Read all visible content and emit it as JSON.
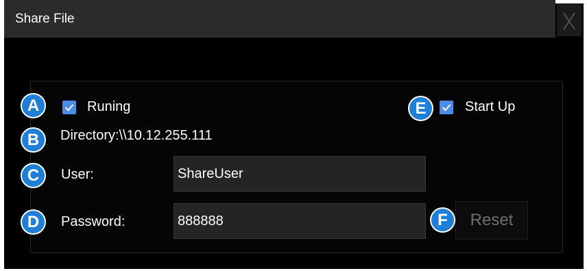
{
  "dialog": {
    "title": "Share File",
    "close_icon": "close-icon"
  },
  "badges": [
    "A",
    "B",
    "C",
    "D",
    "E",
    "F"
  ],
  "running": {
    "label": "Runing",
    "checked": true
  },
  "startup": {
    "label": "Start Up",
    "checked": true
  },
  "directory": {
    "label": "Directory:\\\\10.12.255.111"
  },
  "user": {
    "label": "User:",
    "value": "ShareUser"
  },
  "password": {
    "label": "Password:",
    "value": "888888"
  },
  "reset": {
    "label": "Reset"
  },
  "colors": {
    "background": "#000000",
    "titlebar": "#2b2b2b",
    "badge": "#1f7fd6",
    "checkbox": "#4a8de6",
    "input_bg": "#242424"
  }
}
